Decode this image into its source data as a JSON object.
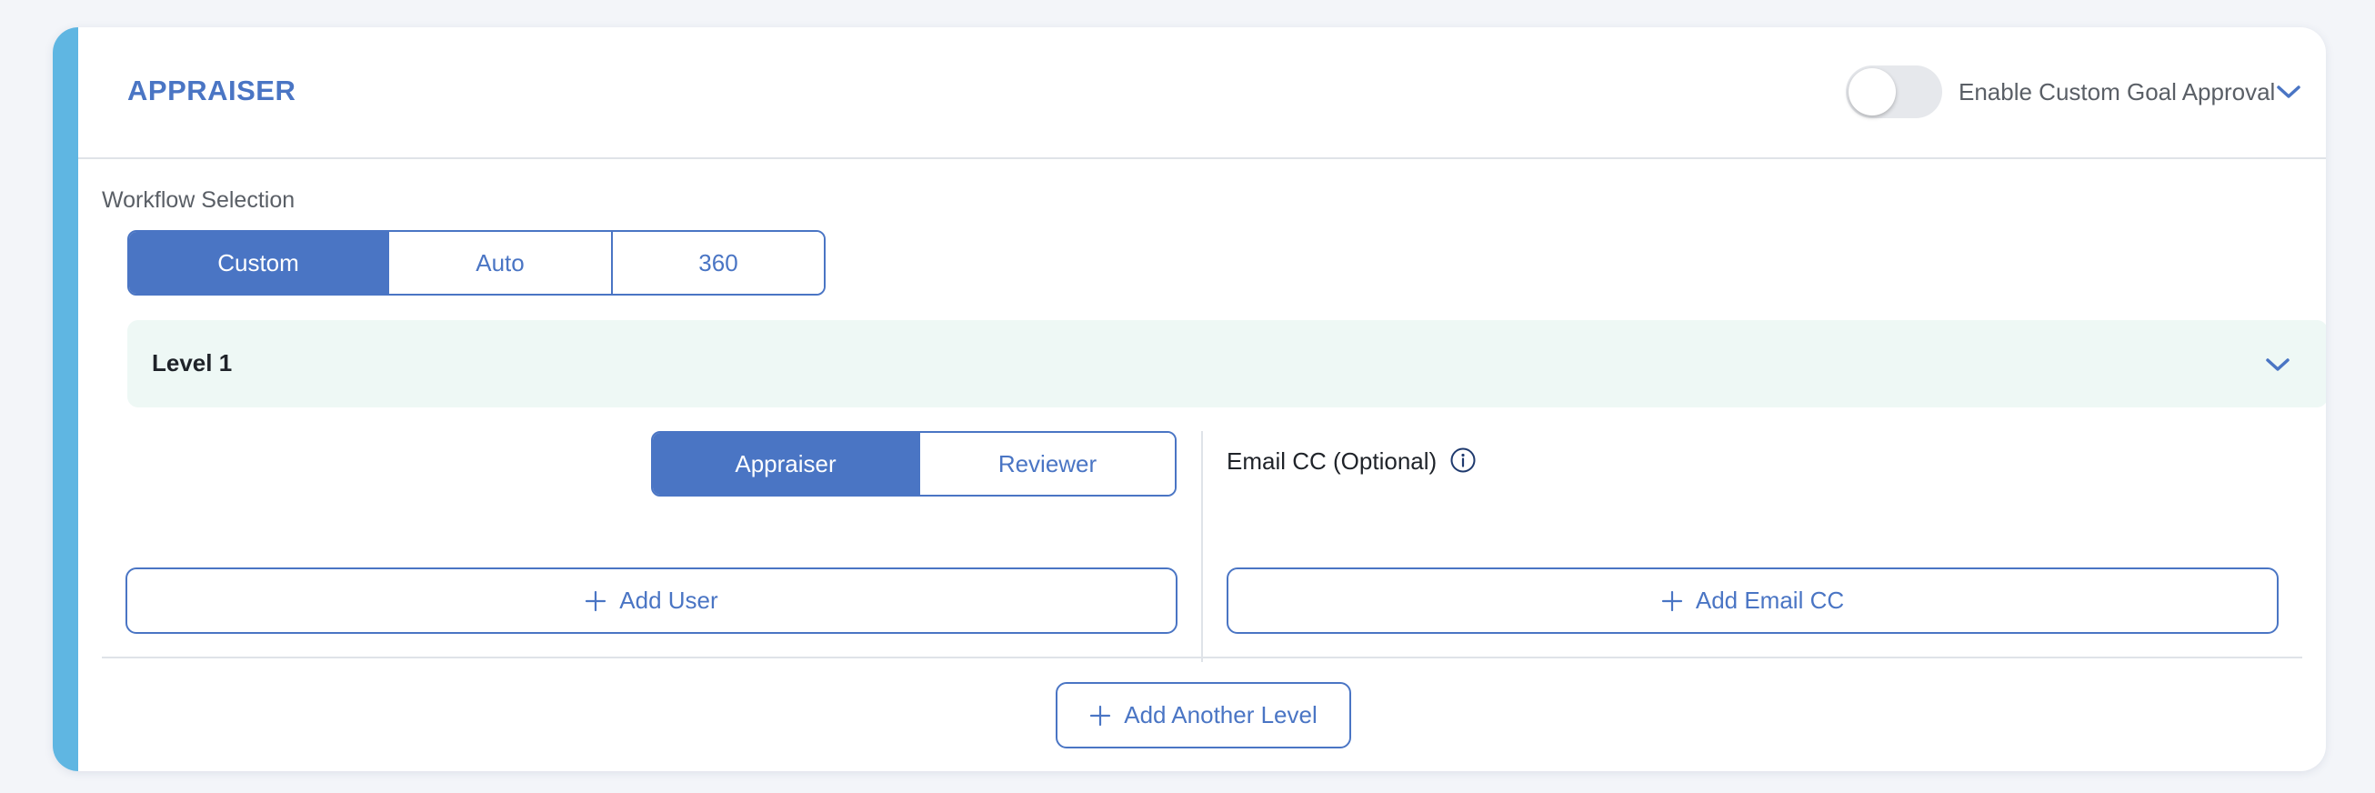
{
  "section": {
    "title": "APPRAISER",
    "toggle_label": "Enable Custom Goal Approval",
    "toggle_on": false
  },
  "workflow": {
    "label": "Workflow Selection",
    "options": [
      "Custom",
      "Auto",
      "360"
    ],
    "selected": "Custom"
  },
  "level": {
    "title": "Level 1",
    "roles": [
      "Appraiser",
      "Reviewer"
    ],
    "selected_role": "Appraiser",
    "add_user_label": "Add User",
    "email_cc_label": "Email CC (Optional)",
    "add_email_cc_label": "Add Email CC"
  },
  "add_another_level_label": "Add Another Level",
  "colors": {
    "accent": "#4a75c4",
    "side_bar": "#5fb6e2",
    "level_bg": "#eef8f5"
  },
  "icons": {
    "header_chevron": "chevron-down-icon",
    "level_chevron": "chevron-down-icon",
    "info": "info-icon",
    "plus": "plus-icon"
  }
}
